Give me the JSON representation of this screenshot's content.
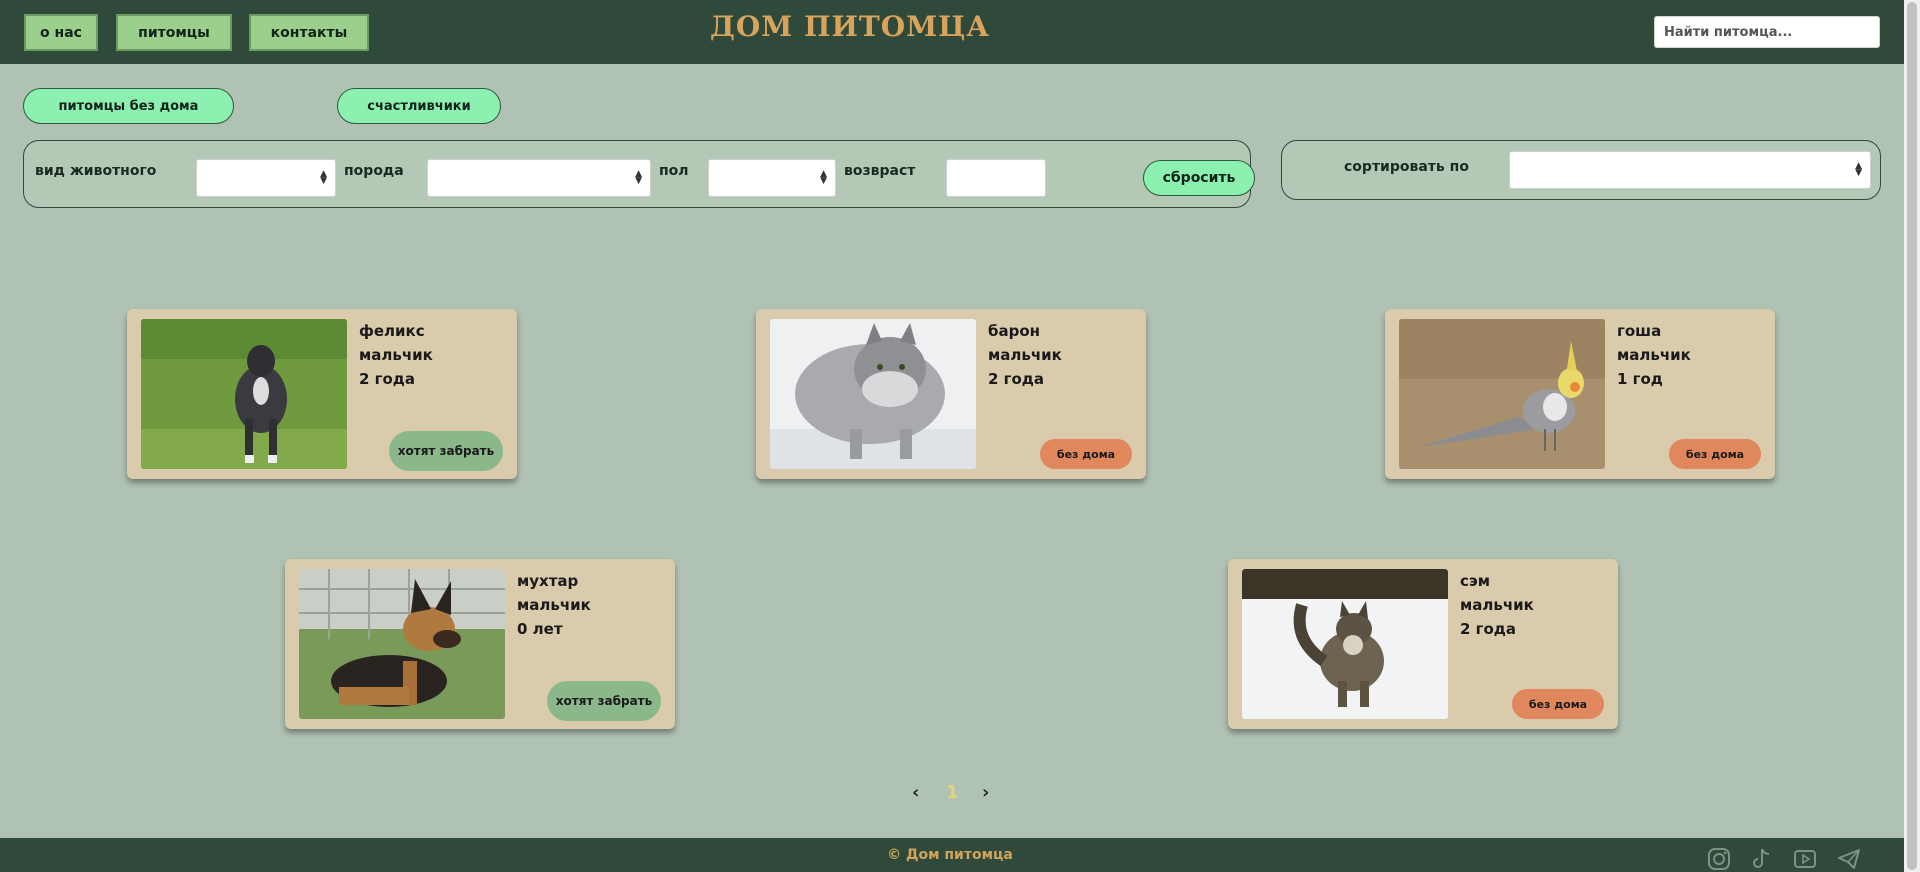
{
  "header": {
    "nav": [
      {
        "label": "О нас"
      },
      {
        "label": "Питомцы"
      },
      {
        "label": "Контакты"
      }
    ],
    "title": "ДОМ ПИТОМЦА",
    "search_placeholder": "Найти питомца..."
  },
  "tabs": [
    {
      "label": "Питомцы без дома"
    },
    {
      "label": "Счастливчики"
    }
  ],
  "filters": {
    "species_label": "Вид животного",
    "breed_label": "Порода",
    "sex_label": "Пол",
    "age_label": "Возвраст",
    "reset_label": "Сбросить",
    "sort_label": "Сортировать по"
  },
  "pets": [
    {
      "name": "Феликс",
      "sex": "мальчик",
      "age": "2 года",
      "status": "Хотят забрать",
      "photo_icon": "dog-photo"
    },
    {
      "name": "Барон",
      "sex": "мальчик",
      "age": "2 года",
      "status": "Без дома",
      "photo_icon": "cat-photo"
    },
    {
      "name": "Гоша",
      "sex": "мальчик",
      "age": "1 год",
      "status": "Без дома",
      "photo_icon": "parrot-photo"
    },
    {
      "name": "Мухтар",
      "sex": "мальчик",
      "age": "0 лет",
      "status": "Хотят забрать",
      "photo_icon": "puppy-photo"
    },
    {
      "name": "Сэм",
      "sex": "мальчик",
      "age": "2 года",
      "status": "Без дома",
      "photo_icon": "cat-photo"
    }
  ],
  "pagination": {
    "prev": "‹",
    "current": "1",
    "next": "›"
  },
  "footer": {
    "copyright": "© Дом питомца",
    "social_icons": [
      "instagram-icon",
      "tiktok-icon",
      "youtube-icon",
      "telegram-icon"
    ]
  },
  "colors": {
    "header_bg": "#2f4a3a",
    "page_bg": "#b0c2b3",
    "title": "#d8a45c",
    "card_bg": "#d9cbab",
    "want_badge": "#8ab88a",
    "homeless_badge": "#e0875c",
    "pill_bg": "#8cf0b0"
  }
}
